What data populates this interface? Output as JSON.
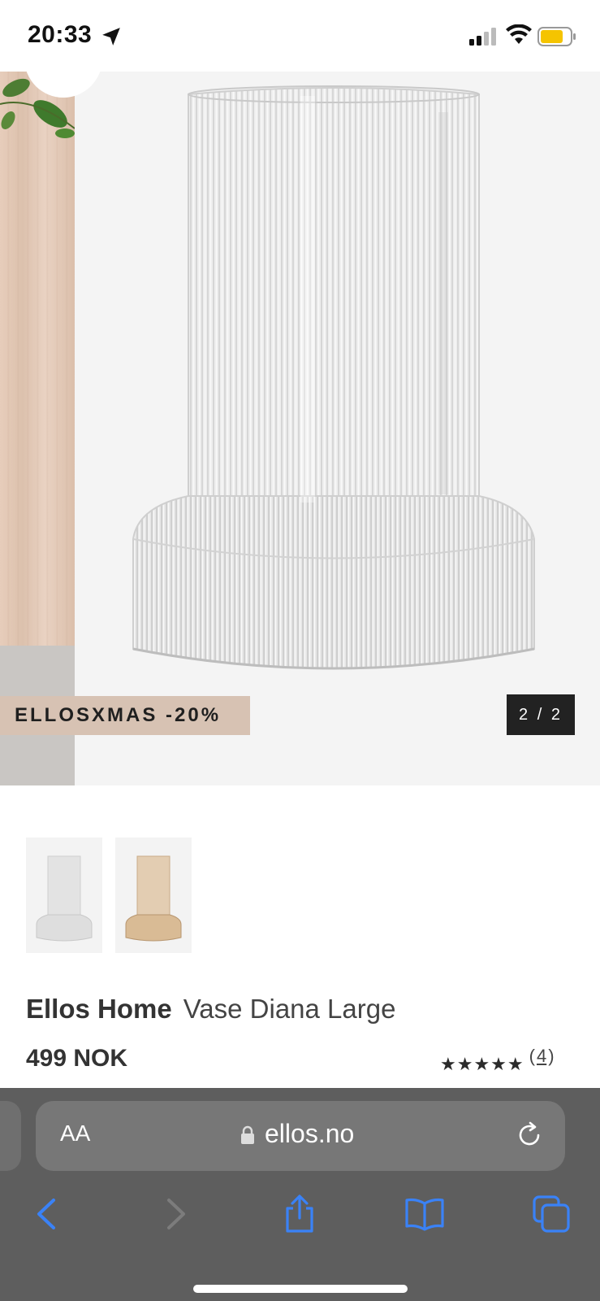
{
  "status_bar": {
    "time": "20:33"
  },
  "hero": {
    "promo_label": "ELLOSXMAS -20%",
    "pager": "2 / 2"
  },
  "product": {
    "brand": "Ellos Home",
    "name": "Vase Diana Large",
    "price": "499 NOK",
    "rating_stars": "★★★★★",
    "rating_count": "4"
  },
  "browser": {
    "text_size_label": "AA",
    "url": "ellos.no"
  },
  "colors": {
    "promo_bg": "#d7c2b3",
    "toolbar_bg": "#5e5e5e",
    "ios_blue": "#3a82f7"
  }
}
